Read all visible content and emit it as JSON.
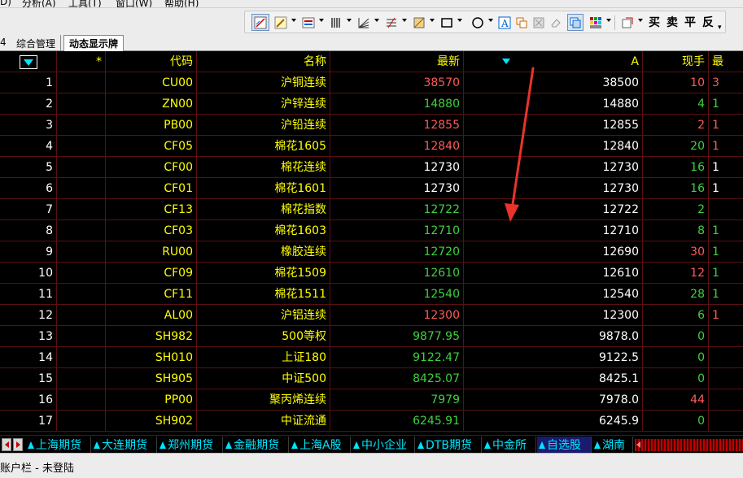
{
  "menu": {
    "items": [
      "D)",
      "分析(A)",
      "工具(T)",
      "窗口(W)",
      "帮助(H)"
    ]
  },
  "toolbar": {
    "trade_labels": [
      "买",
      "卖",
      "平",
      "反"
    ],
    "icons": [
      "line-draw-icon",
      "pen-icon",
      "text-style-icon",
      "bars-icon",
      "fan-lines-icon",
      "fib-lines-icon",
      "pattern-icon",
      "rectangle-icon",
      "circle-icon",
      "text-icon",
      "copy-icon",
      "delete-icon",
      "eraser-icon",
      "layer-icon",
      "color-grid-icon",
      "options-icon"
    ]
  },
  "tabs": {
    "edge": "4",
    "items": [
      {
        "label": "综合管理",
        "active": false
      },
      {
        "label": "动态显示牌",
        "active": true
      }
    ]
  },
  "grid": {
    "headers": [
      "",
      "*",
      "代码",
      "名称",
      "最新",
      "",
      "A",
      "现手",
      "最"
    ],
    "rows": [
      {
        "no": "1",
        "code": "CU00",
        "name": "沪铜连续",
        "last": "38570",
        "last_color": "red",
        "a": "38500",
        "vol": "10",
        "vol_color": "red",
        "ext": "3",
        "ext_color": "red"
      },
      {
        "no": "2",
        "code": "ZN00",
        "name": "沪锌连续",
        "last": "14880",
        "last_color": "green",
        "a": "14880",
        "vol": "4",
        "vol_color": "green",
        "ext": "1",
        "ext_color": "green"
      },
      {
        "no": "3",
        "code": "PB00",
        "name": "沪铅连续",
        "last": "12855",
        "last_color": "red",
        "a": "12855",
        "vol": "2",
        "vol_color": "red",
        "ext": "1",
        "ext_color": "red"
      },
      {
        "no": "4",
        "code": "CF05",
        "name": "棉花1605",
        "last": "12840",
        "last_color": "red",
        "a": "12840",
        "vol": "20",
        "vol_color": "green",
        "ext": "1",
        "ext_color": "red"
      },
      {
        "no": "5",
        "code": "CF00",
        "name": "棉花连续",
        "last": "12730",
        "last_color": "white",
        "a": "12730",
        "vol": "16",
        "vol_color": "green",
        "ext": "1",
        "ext_color": "white"
      },
      {
        "no": "6",
        "code": "CF01",
        "name": "棉花1601",
        "last": "12730",
        "last_color": "white",
        "a": "12730",
        "vol": "16",
        "vol_color": "green",
        "ext": "1",
        "ext_color": "white"
      },
      {
        "no": "7",
        "code": "CF13",
        "name": "棉花指数",
        "last": "12722",
        "last_color": "green",
        "a": "12722",
        "vol": "2",
        "vol_color": "green",
        "ext": "",
        "ext_color": "green"
      },
      {
        "no": "8",
        "code": "CF03",
        "name": "棉花1603",
        "last": "12710",
        "last_color": "green",
        "a": "12710",
        "vol": "8",
        "vol_color": "green",
        "ext": "1",
        "ext_color": "green"
      },
      {
        "no": "9",
        "code": "RU00",
        "name": "橡胶连续",
        "last": "12720",
        "last_color": "green",
        "a": "12690",
        "vol": "30",
        "vol_color": "red",
        "ext": "1",
        "ext_color": "green"
      },
      {
        "no": "10",
        "code": "CF09",
        "name": "棉花1509",
        "last": "12610",
        "last_color": "green",
        "a": "12610",
        "vol": "12",
        "vol_color": "red",
        "ext": "1",
        "ext_color": "green"
      },
      {
        "no": "11",
        "code": "CF11",
        "name": "棉花1511",
        "last": "12540",
        "last_color": "green",
        "a": "12540",
        "vol": "28",
        "vol_color": "green",
        "ext": "1",
        "ext_color": "green"
      },
      {
        "no": "12",
        "code": "AL00",
        "name": "沪铝连续",
        "last": "12300",
        "last_color": "red",
        "a": "12300",
        "vol": "6",
        "vol_color": "green",
        "ext": "1",
        "ext_color": "red"
      },
      {
        "no": "13",
        "code": "SH982",
        "name": "500等权",
        "last": "9877.95",
        "last_color": "green",
        "a": "9878.0",
        "vol": "0",
        "vol_color": "green",
        "ext": "",
        "ext_color": "green"
      },
      {
        "no": "14",
        "code": "SH010",
        "name": "上证180",
        "last": "9122.47",
        "last_color": "green",
        "a": "9122.5",
        "vol": "0",
        "vol_color": "green",
        "ext": "",
        "ext_color": "green"
      },
      {
        "no": "15",
        "code": "SH905",
        "name": "中证500",
        "last": "8425.07",
        "last_color": "green",
        "a": "8425.1",
        "vol": "0",
        "vol_color": "green",
        "ext": "",
        "ext_color": "green"
      },
      {
        "no": "16",
        "code": "PP00",
        "name": "聚丙烯连续",
        "last": "7979",
        "last_color": "green",
        "a": "7978.0",
        "vol": "44",
        "vol_color": "red",
        "ext": "",
        "ext_color": "green"
      },
      {
        "no": "17",
        "code": "SH902",
        "name": "中证流通",
        "last": "6245.91",
        "last_color": "green",
        "a": "6245.9",
        "vol": "0",
        "vol_color": "green",
        "ext": "",
        "ext_color": "green"
      }
    ]
  },
  "categories": [
    {
      "label": "上海期货",
      "active": false
    },
    {
      "label": "大连期货",
      "active": false
    },
    {
      "label": "郑州期货",
      "active": false
    },
    {
      "label": "金融期货",
      "active": false
    },
    {
      "label": "上海A股",
      "active": false
    },
    {
      "label": "中小企业",
      "active": false
    },
    {
      "label": "DTB期货",
      "active": false
    },
    {
      "label": "中金所",
      "active": false
    },
    {
      "label": "自选股",
      "active": true
    },
    {
      "label": "湖南",
      "active": false
    }
  ],
  "status": {
    "text": "账户栏 - 未登陆"
  },
  "colors": {
    "background": "#000000",
    "grid_line": "#5a1010",
    "code_name": "#ffff00",
    "up": "#ff5a5a",
    "down": "#3ed13e",
    "category": "#00e5ff",
    "arrow": "#e8332a"
  }
}
